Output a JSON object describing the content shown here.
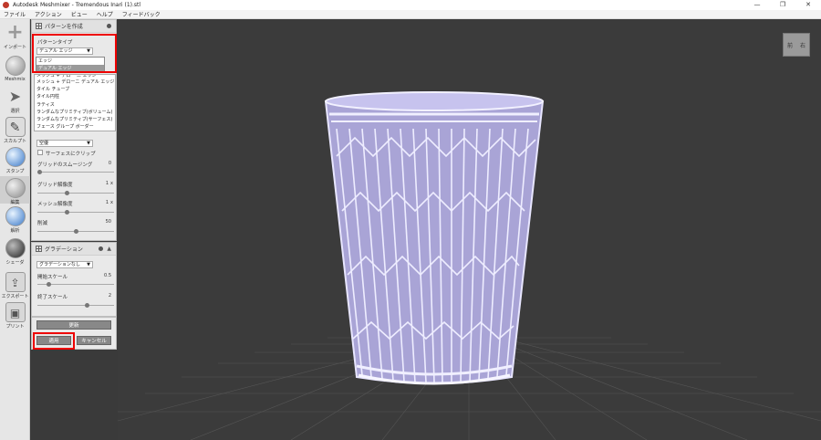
{
  "window": {
    "title": "Autodesk Meshmixer - Tremendous Inari (1).stl",
    "controls": [
      "—",
      "❐",
      "✕"
    ]
  },
  "menu": [
    "ファイル",
    "アクション",
    "ビュー",
    "ヘルプ",
    "フィードバック"
  ],
  "toolbar": [
    {
      "label": "インポート",
      "icon": "plus-icon"
    },
    {
      "label": "Meshmix",
      "icon": "meshmix-icon"
    },
    {
      "label": "選択",
      "icon": "select-arrow-icon"
    },
    {
      "label": "スカルプト",
      "icon": "brush-icon"
    },
    {
      "label": "スタンプ",
      "icon": "stamp-icon"
    },
    {
      "label": "編集",
      "icon": "edit-icon"
    },
    {
      "label": "解析",
      "icon": "analysis-icon"
    },
    {
      "label": "シェーダ",
      "icon": "shader-icon"
    },
    {
      "label": "エクスポート",
      "icon": "export-icon"
    },
    {
      "label": "プリント",
      "icon": "print-icon"
    }
  ],
  "pattern_panel": {
    "title": "パターンを作成",
    "type_label": "パターンタイプ",
    "type_value": "デュアル エッジ",
    "dropdown_open": [
      "エッジ",
      "デュアル エッジ"
    ],
    "dropdown_list": [
      "メッシュ + デロー ニ エッジ",
      "メッシュ + デローニ デュアル エッジ",
      "タイル チューブ",
      "タイル円柱",
      "ラティス",
      "ランダムなプリミティブ(ボリューム)",
      "ランダムなプリミティブ(サーフェス)",
      "フェース グループ ボーダー"
    ],
    "fill_value": "空優",
    "surface_clip_label": "サーフェスにクリップ",
    "grid_smooth_label": "グリッドのスムージング",
    "grid_smooth_value": "0",
    "grid_res_label": "グリッド解像度",
    "grid_res_value": "1",
    "grid_res_unit": "x",
    "mesh_res_label": "メッシュ解像度",
    "mesh_res_value": "1",
    "mesh_res_unit": "x",
    "reduce_label": "削減",
    "reduce_value": "50"
  },
  "gradation_panel": {
    "title": "グラデーション",
    "mode_value": "グラデーションなし",
    "start_scale_label": "開始スケール",
    "start_scale_value": "0.5",
    "end_scale_label": "終了スケール",
    "end_scale_value": "2"
  },
  "actions": {
    "update_label": "更新",
    "apply_label": "適用",
    "cancel_label": "キャンセル"
  },
  "nav_cube": {
    "front": "前",
    "right": "右"
  }
}
